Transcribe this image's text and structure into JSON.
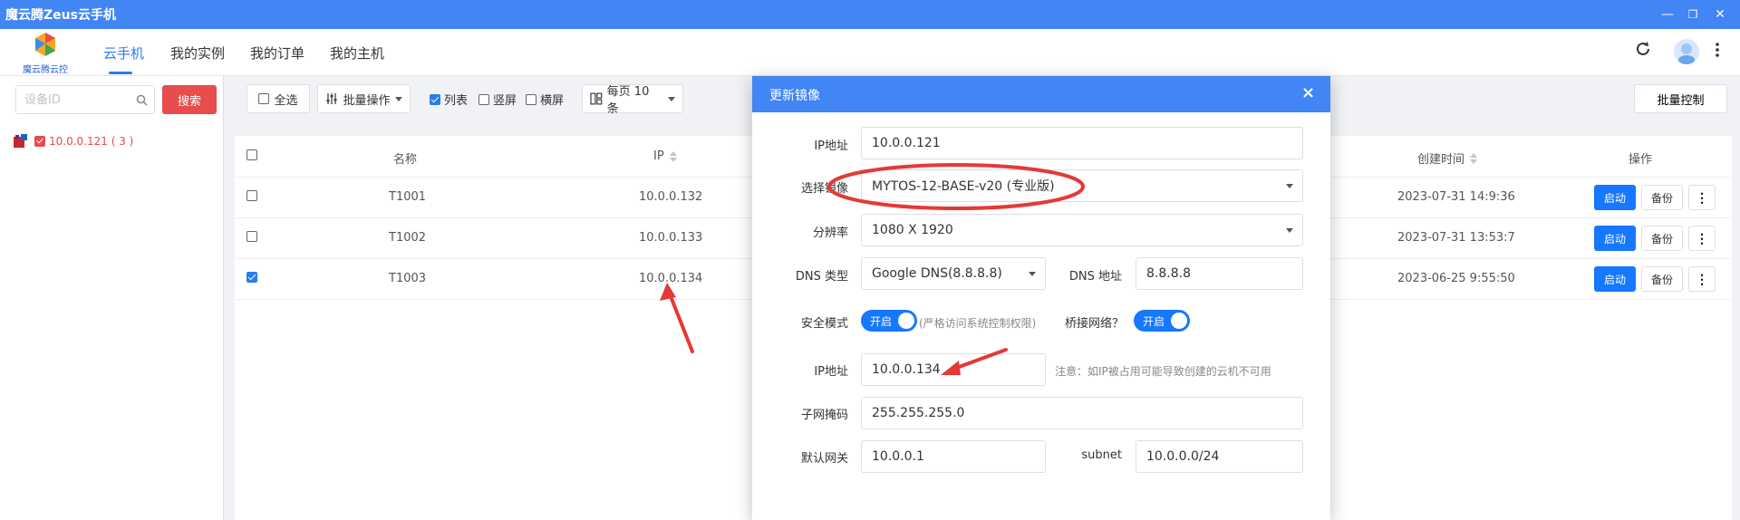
{
  "window": {
    "title": "魔云腾Zeus云手机",
    "minimize": "—",
    "restore": "❐",
    "close": "✕"
  },
  "nav": {
    "logo_text": "魔云腾云控",
    "tabs": [
      "云手机",
      "我的实例",
      "我的订单",
      "我的主机"
    ],
    "active_tab": "云手机"
  },
  "sidebar": {
    "search_placeholder": "设备ID",
    "search_button": "搜索",
    "tree_item": "10.0.0.121 ( 3 )"
  },
  "toolbar": {
    "select_all": "全选",
    "batch_ops": "批量操作",
    "view_list": "列表",
    "view_portrait": "竖屏",
    "view_landscape": "横屏",
    "per_page": "每页 10 条",
    "batch_control": "批量控制"
  },
  "table": {
    "headers": {
      "name": "名称",
      "ip": "IP",
      "created": "创建时间",
      "actions": "操作"
    },
    "rows": [
      {
        "name": "T1001",
        "ip": "10.0.0.132",
        "created": "2023-07-31 14:9:36",
        "checked": false
      },
      {
        "name": "T1002",
        "ip": "10.0.0.133",
        "created": "2023-07-31 13:53:7",
        "checked": false
      },
      {
        "name": "T1003",
        "ip": "10.0.0.134",
        "created": "2023-06-25 9:55:50",
        "checked": true
      }
    ],
    "btn_start": "启动",
    "btn_backup": "备份",
    "btn_more": "⋮"
  },
  "modal": {
    "title": "更新镜像",
    "close": "×",
    "ip_label": "IP地址",
    "ip_value": "10.0.0.121",
    "image_label": "选择镜像",
    "image_value": "MYTOS-12-BASE-v20 (专业版)",
    "resolution_label": "分辨率",
    "resolution_value": "1080 X 1920",
    "dns_type_label": "DNS 类型",
    "dns_type_value": "Google DNS(8.8.8.8)",
    "dns_addr_label": "DNS 地址",
    "dns_addr_value": "8.8.8.8",
    "safe_mode_label": "安全模式",
    "safe_mode_toggle": "开启",
    "safe_mode_note": "(严格访问系统控制权限)",
    "bridge_label": "桥接网络？",
    "bridge_toggle": "开启",
    "ip2_label": "IP地址",
    "ip2_value": "10.0.0.134",
    "ip2_note": "注意：如IP被占用可能导致创建的云机不可用",
    "subnet_mask_label": "子网掩码",
    "subnet_mask_value": "255.255.255.0",
    "gateway_label": "默认网关",
    "gateway_value": "10.0.0.1",
    "subnet_label": "subnet",
    "subnet_value": "10.0.0.0/24"
  },
  "colors": {
    "primary": "#4285f4",
    "accent_blue": "#1677ff",
    "danger": "#e84c4c",
    "annotation": "#e53935"
  }
}
